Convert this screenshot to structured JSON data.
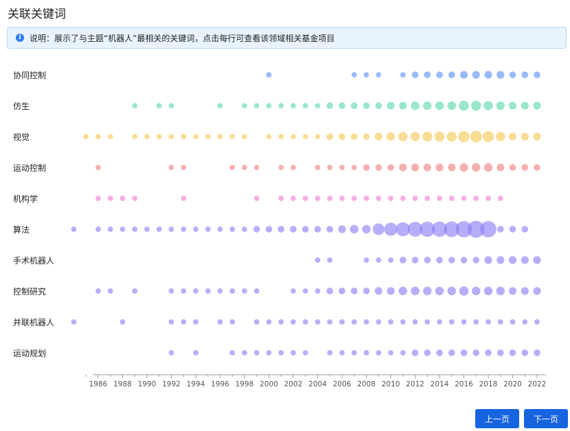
{
  "page": {
    "title": "关联关键词",
    "notice": "说明：展示了与主题“机器人”最相关的关键词，点击每行可查看该领域相关基金项目",
    "prev_label": "上一页",
    "next_label": "下一页"
  },
  "chart_data": {
    "type": "scatter",
    "title": "",
    "xlabel": "",
    "ylabel": "",
    "x_range": [
      1985,
      2022
    ],
    "x_tick_labels": [
      "1986",
      "1988",
      "1990",
      "1992",
      "1994",
      "1996",
      "1998",
      "2000",
      "2002",
      "2004",
      "2006",
      "2008",
      "2010",
      "2012",
      "2014",
      "2016",
      "2018",
      "2020",
      "2022"
    ],
    "encoding": "bubble size = relative weight of keyword in that year",
    "grid": false,
    "legend": "none",
    "series": [
      {
        "name": "协同控制",
        "color": "#5b8ff9",
        "points": [
          [
            2000,
            1
          ],
          [
            2007,
            1
          ],
          [
            2008,
            1
          ],
          [
            2009,
            1
          ],
          [
            2011,
            1
          ],
          [
            2012,
            2
          ],
          [
            2013,
            2
          ],
          [
            2014,
            2
          ],
          [
            2015,
            2
          ],
          [
            2016,
            3
          ],
          [
            2017,
            3
          ],
          [
            2018,
            3
          ],
          [
            2019,
            3
          ],
          [
            2020,
            2
          ],
          [
            2021,
            2
          ],
          [
            2022,
            2
          ]
        ]
      },
      {
        "name": "仿生",
        "color": "#5ad8a6",
        "points": [
          [
            1989,
            1
          ],
          [
            1991,
            1
          ],
          [
            1992,
            1
          ],
          [
            1996,
            1
          ],
          [
            1998,
            1
          ],
          [
            1999,
            1
          ],
          [
            2000,
            1
          ],
          [
            2001,
            1
          ],
          [
            2002,
            1
          ],
          [
            2003,
            1
          ],
          [
            2004,
            1
          ],
          [
            2005,
            2
          ],
          [
            2006,
            2
          ],
          [
            2007,
            2
          ],
          [
            2008,
            2
          ],
          [
            2009,
            2
          ],
          [
            2010,
            3
          ],
          [
            2011,
            3
          ],
          [
            2012,
            4
          ],
          [
            2013,
            4
          ],
          [
            2014,
            4
          ],
          [
            2015,
            4
          ],
          [
            2016,
            6
          ],
          [
            2017,
            6
          ],
          [
            2018,
            5
          ],
          [
            2019,
            4
          ],
          [
            2020,
            3
          ],
          [
            2021,
            3
          ],
          [
            2022,
            3
          ]
        ]
      },
      {
        "name": "视觉",
        "color": "#f6c654",
        "points": [
          [
            1985,
            1
          ],
          [
            1986,
            1
          ],
          [
            1987,
            1
          ],
          [
            1989,
            1
          ],
          [
            1990,
            1
          ],
          [
            1991,
            1
          ],
          [
            1992,
            1
          ],
          [
            1993,
            1
          ],
          [
            1994,
            1
          ],
          [
            1995,
            1
          ],
          [
            1996,
            1
          ],
          [
            1997,
            1
          ],
          [
            1998,
            1
          ],
          [
            2000,
            1
          ],
          [
            2001,
            1
          ],
          [
            2002,
            1
          ],
          [
            2003,
            1
          ],
          [
            2004,
            1
          ],
          [
            2005,
            2
          ],
          [
            2006,
            2
          ],
          [
            2007,
            2
          ],
          [
            2008,
            2
          ],
          [
            2009,
            3
          ],
          [
            2010,
            4
          ],
          [
            2011,
            5
          ],
          [
            2012,
            5
          ],
          [
            2013,
            6
          ],
          [
            2014,
            6
          ],
          [
            2015,
            6
          ],
          [
            2016,
            8
          ],
          [
            2017,
            9
          ],
          [
            2018,
            8
          ],
          [
            2019,
            5
          ],
          [
            2020,
            3
          ],
          [
            2021,
            3
          ],
          [
            2022,
            3
          ]
        ]
      },
      {
        "name": "运动控制",
        "color": "#f08080",
        "points": [
          [
            1986,
            1
          ],
          [
            1992,
            1
          ],
          [
            1993,
            1
          ],
          [
            1997,
            1
          ],
          [
            1998,
            1
          ],
          [
            1999,
            1
          ],
          [
            2001,
            1
          ],
          [
            2002,
            1
          ],
          [
            2004,
            1
          ],
          [
            2005,
            1
          ],
          [
            2006,
            1
          ],
          [
            2007,
            1
          ],
          [
            2008,
            2
          ],
          [
            2009,
            2
          ],
          [
            2010,
            2
          ],
          [
            2011,
            3
          ],
          [
            2012,
            3
          ],
          [
            2013,
            3
          ],
          [
            2014,
            3
          ],
          [
            2015,
            3
          ],
          [
            2016,
            4
          ],
          [
            2017,
            4
          ],
          [
            2018,
            4
          ],
          [
            2019,
            3
          ],
          [
            2020,
            2
          ],
          [
            2021,
            2
          ],
          [
            2022,
            2
          ]
        ]
      },
      {
        "name": "机构学",
        "color": "#f07ad4",
        "points": [
          [
            1986,
            1
          ],
          [
            1987,
            1
          ],
          [
            1988,
            1
          ],
          [
            1989,
            1
          ],
          [
            1993,
            1
          ],
          [
            1999,
            1
          ],
          [
            2001,
            1
          ],
          [
            2002,
            1
          ],
          [
            2003,
            1
          ],
          [
            2004,
            1
          ],
          [
            2005,
            1
          ],
          [
            2006,
            1
          ],
          [
            2007,
            1
          ],
          [
            2008,
            1
          ],
          [
            2009,
            1
          ],
          [
            2010,
            1
          ],
          [
            2011,
            1
          ],
          [
            2012,
            1
          ],
          [
            2013,
            1
          ],
          [
            2014,
            1
          ],
          [
            2015,
            1
          ],
          [
            2016,
            1
          ],
          [
            2017,
            1
          ],
          [
            2018,
            1
          ],
          [
            2019,
            1
          ]
        ]
      },
      {
        "name": "算法",
        "color": "#8b7cf6",
        "points": [
          [
            1984,
            1
          ],
          [
            1986,
            1
          ],
          [
            1987,
            1
          ],
          [
            1988,
            1
          ],
          [
            1989,
            1
          ],
          [
            1990,
            1
          ],
          [
            1991,
            1
          ],
          [
            1992,
            1
          ],
          [
            1993,
            1
          ],
          [
            1994,
            1
          ],
          [
            1995,
            1
          ],
          [
            1996,
            1
          ],
          [
            1997,
            1
          ],
          [
            1998,
            1
          ],
          [
            1999,
            2
          ],
          [
            2000,
            2
          ],
          [
            2001,
            2
          ],
          [
            2002,
            2
          ],
          [
            2003,
            2
          ],
          [
            2004,
            2
          ],
          [
            2005,
            2
          ],
          [
            2006,
            3
          ],
          [
            2007,
            4
          ],
          [
            2008,
            4
          ],
          [
            2009,
            9
          ],
          [
            2010,
            12
          ],
          [
            2011,
            14
          ],
          [
            2012,
            16
          ],
          [
            2013,
            17
          ],
          [
            2014,
            17
          ],
          [
            2015,
            18
          ],
          [
            2016,
            20
          ],
          [
            2017,
            22
          ],
          [
            2018,
            20
          ],
          [
            2019,
            2
          ],
          [
            2020,
            2
          ],
          [
            2021,
            2
          ]
        ]
      },
      {
        "name": "手术机器人",
        "color": "#8b7cf6",
        "points": [
          [
            2004,
            1
          ],
          [
            2005,
            1
          ],
          [
            2008,
            1
          ],
          [
            2009,
            1
          ],
          [
            2010,
            1
          ],
          [
            2011,
            2
          ],
          [
            2012,
            2
          ],
          [
            2013,
            2
          ],
          [
            2014,
            2
          ],
          [
            2015,
            2
          ],
          [
            2016,
            2
          ],
          [
            2017,
            2
          ],
          [
            2018,
            3
          ],
          [
            2019,
            3
          ],
          [
            2020,
            3
          ],
          [
            2021,
            3
          ],
          [
            2022,
            3
          ]
        ]
      },
      {
        "name": "控制研究",
        "color": "#8b7cf6",
        "points": [
          [
            1986,
            1
          ],
          [
            1987,
            1
          ],
          [
            1989,
            1
          ],
          [
            1992,
            1
          ],
          [
            1993,
            1
          ],
          [
            1994,
            1
          ],
          [
            1995,
            1
          ],
          [
            1996,
            1
          ],
          [
            1997,
            1
          ],
          [
            1998,
            1
          ],
          [
            1999,
            1
          ],
          [
            2002,
            1
          ],
          [
            2003,
            1
          ],
          [
            2004,
            1
          ],
          [
            2005,
            2
          ],
          [
            2006,
            2
          ],
          [
            2007,
            2
          ],
          [
            2008,
            2
          ],
          [
            2009,
            3
          ],
          [
            2010,
            3
          ],
          [
            2011,
            4
          ],
          [
            2012,
            4
          ],
          [
            2013,
            4
          ],
          [
            2014,
            4
          ],
          [
            2015,
            4
          ],
          [
            2016,
            5
          ],
          [
            2017,
            4
          ],
          [
            2018,
            4
          ],
          [
            2019,
            4
          ],
          [
            2020,
            3
          ],
          [
            2021,
            3
          ],
          [
            2022,
            3
          ]
        ]
      },
      {
        "name": "并联机器人",
        "color": "#8b7cf6",
        "points": [
          [
            1984,
            1
          ],
          [
            1988,
            1
          ],
          [
            1992,
            1
          ],
          [
            1993,
            1
          ],
          [
            1994,
            1
          ],
          [
            1996,
            1
          ],
          [
            1997,
            1
          ],
          [
            1999,
            1
          ],
          [
            2000,
            1
          ],
          [
            2001,
            1
          ],
          [
            2002,
            1
          ],
          [
            2003,
            1
          ],
          [
            2004,
            1
          ],
          [
            2005,
            1
          ],
          [
            2006,
            1
          ],
          [
            2007,
            1
          ],
          [
            2008,
            1
          ],
          [
            2009,
            1
          ],
          [
            2010,
            1
          ],
          [
            2011,
            1
          ],
          [
            2012,
            1
          ],
          [
            2013,
            1
          ],
          [
            2014,
            1
          ],
          [
            2015,
            1
          ],
          [
            2016,
            1
          ],
          [
            2017,
            1
          ],
          [
            2018,
            1
          ],
          [
            2019,
            1
          ],
          [
            2020,
            1
          ],
          [
            2021,
            1
          ],
          [
            2022,
            1
          ]
        ]
      },
      {
        "name": "运动规划",
        "color": "#8b7cf6",
        "points": [
          [
            1992,
            1
          ],
          [
            1994,
            1
          ],
          [
            1997,
            1
          ],
          [
            1998,
            1
          ],
          [
            1999,
            1
          ],
          [
            2000,
            1
          ],
          [
            2001,
            1
          ],
          [
            2002,
            1
          ],
          [
            2003,
            1
          ],
          [
            2005,
            1
          ],
          [
            2006,
            1
          ],
          [
            2007,
            1
          ],
          [
            2008,
            1
          ],
          [
            2009,
            1
          ],
          [
            2010,
            1
          ],
          [
            2011,
            1
          ],
          [
            2012,
            2
          ],
          [
            2013,
            2
          ],
          [
            2014,
            2
          ],
          [
            2015,
            2
          ],
          [
            2016,
            2
          ],
          [
            2017,
            2
          ],
          [
            2018,
            2
          ],
          [
            2019,
            2
          ],
          [
            2020,
            2
          ],
          [
            2021,
            2
          ],
          [
            2022,
            2
          ]
        ]
      }
    ]
  }
}
